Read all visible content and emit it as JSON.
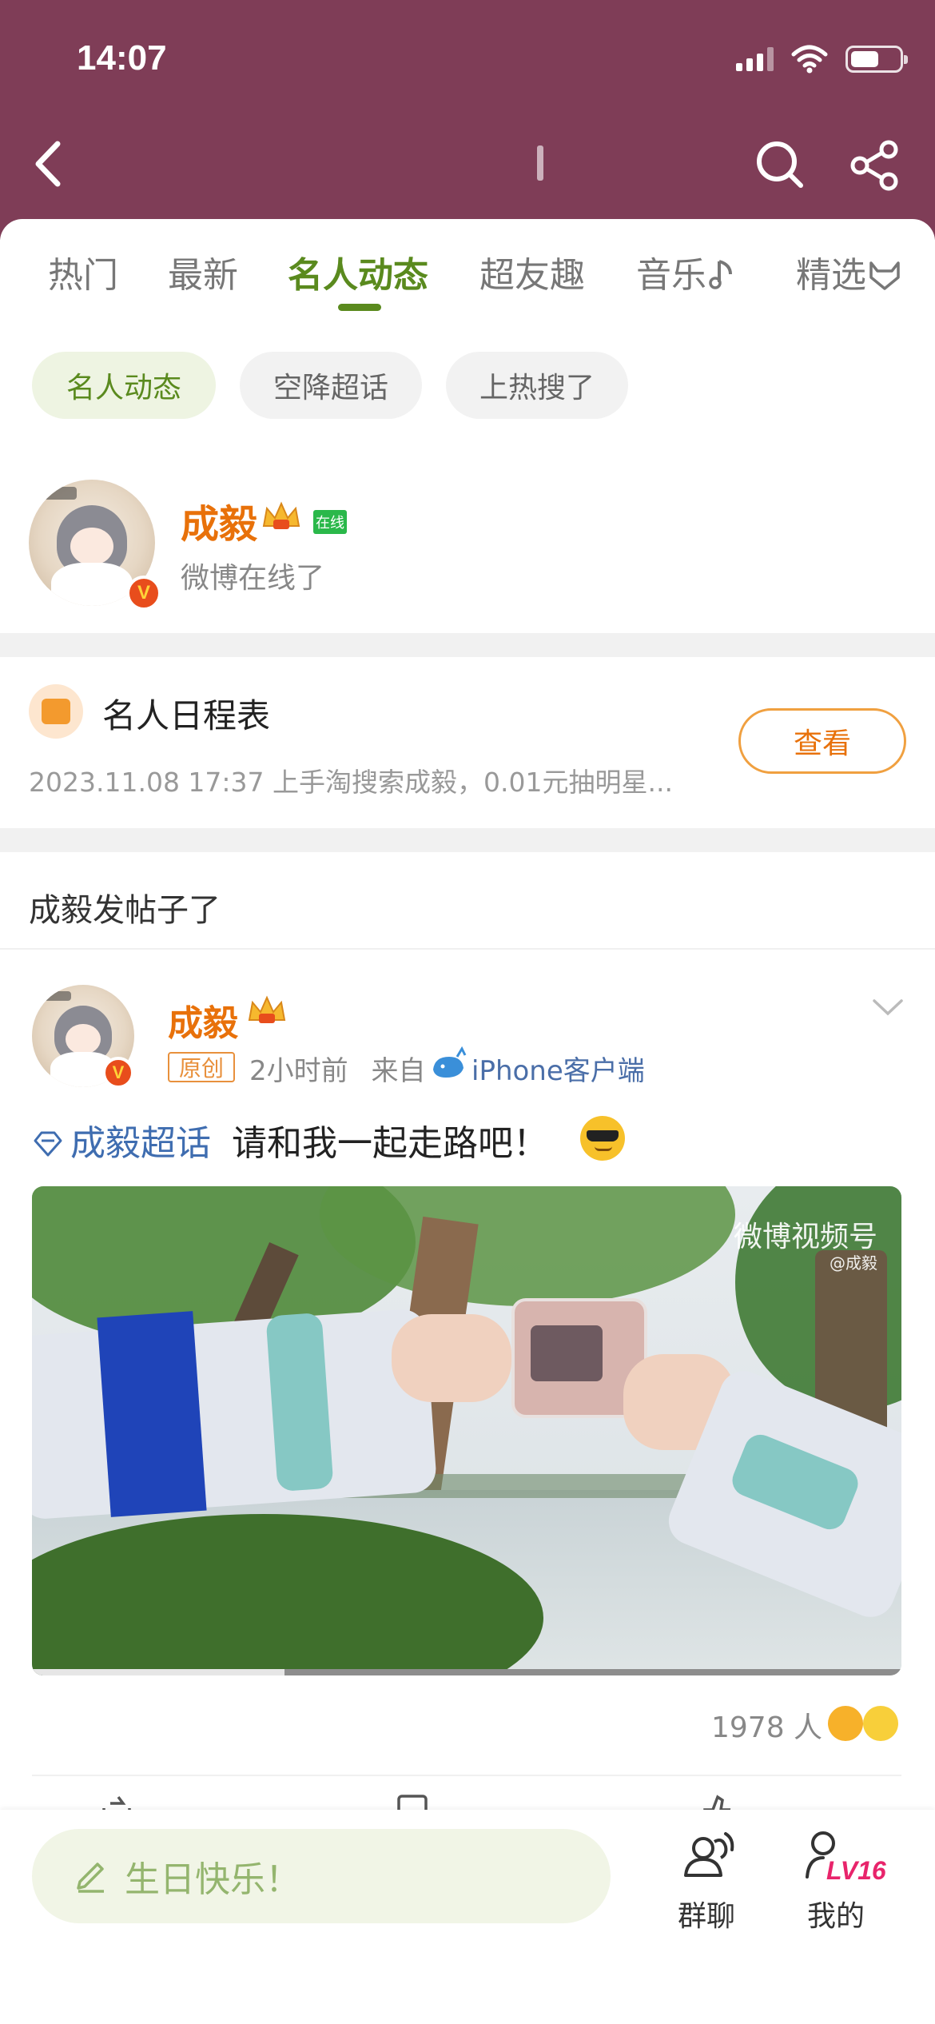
{
  "status_bar": {
    "time": "14:07"
  },
  "tabs": [
    {
      "label": "热门"
    },
    {
      "label": "最新"
    },
    {
      "label": "名人动态"
    },
    {
      "label": "超友趣"
    },
    {
      "label": "音乐"
    },
    {
      "label": "精选"
    }
  ],
  "chips": [
    {
      "label": "名人动态"
    },
    {
      "label": "空降超话"
    },
    {
      "label": "上热搜了"
    }
  ],
  "celebrity": {
    "name": "成毅",
    "online_badge": "在线",
    "status": "微博在线了",
    "verified_mark": "V"
  },
  "schedule": {
    "title": "名人日程表",
    "description": "2023.11.08 17:37 上手淘搜索成毅，0.01元抽明星...",
    "button": "查看"
  },
  "section_title": "成毅发帖子了",
  "post": {
    "author": "成毅",
    "original_badge": "原创",
    "time": "2小时前",
    "from": "来自",
    "source": "iPhone客户端",
    "topic": "成毅超话",
    "text": "请和我一起走路吧！",
    "video": {
      "watermark": "微博视频号",
      "watermark_sub": "@成毅",
      "progress": 0.29
    },
    "likes_count": "1978 人"
  },
  "bottom_bar": {
    "comment_placeholder": "生日快乐！",
    "group_label": "群聊",
    "me_label": "我的",
    "level": "LV16"
  },
  "colors": {
    "header": "#7f3d57",
    "accent_green": "#5a8a1e",
    "orange": "#e8710a",
    "link_blue": "#3f6db0",
    "level_pink": "#e8246b"
  }
}
